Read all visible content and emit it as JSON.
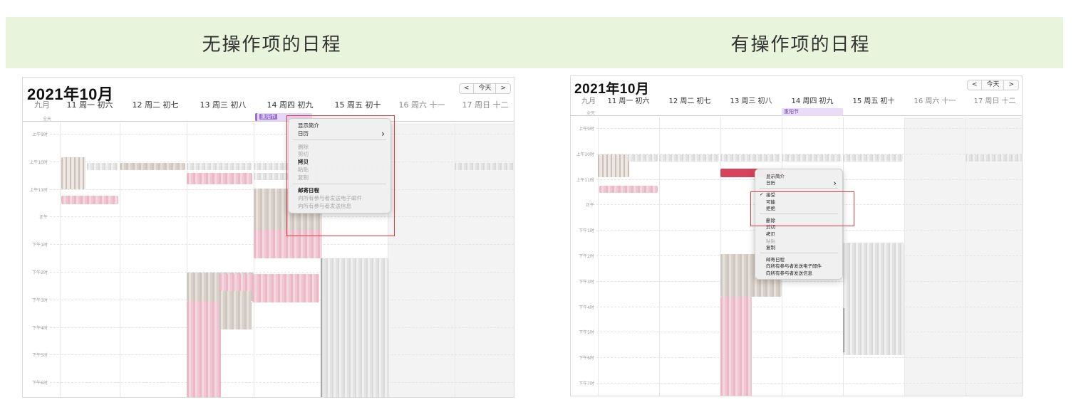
{
  "banners": {
    "left": "无操作项的日程",
    "right": "有操作项的日程"
  },
  "left_calendar": {
    "title": "2021年10月",
    "nav": {
      "prev": "<",
      "today": "今天",
      "next": ">"
    },
    "month_label": "九月",
    "days": [
      {
        "label": "11 周一  初六"
      },
      {
        "label": "12 周二  初七"
      },
      {
        "label": "13 周三  初八"
      },
      {
        "label": "14 周四  初九"
      },
      {
        "label": "15 周五  初十"
      },
      {
        "label": "16 周六  十一"
      },
      {
        "label": "17 周日  十二"
      }
    ],
    "allday_label": "全天",
    "holiday": "重阳节",
    "time_labels": [
      "上午9时",
      "上午10时",
      "上午11时",
      "正午",
      "下午1时",
      "下午2时",
      "下午3时",
      "下午4时",
      "下午5时",
      "下午6时"
    ],
    "menu": {
      "items": [
        {
          "label": "显示简介",
          "disabled": false,
          "bold": false
        },
        {
          "label": "日历",
          "disabled": false,
          "bold": false,
          "submenu": true
        },
        {
          "sep": true
        },
        {
          "label": "删除",
          "disabled": true,
          "bold": false
        },
        {
          "label": "剪切",
          "disabled": true,
          "bold": false
        },
        {
          "label": "拷贝",
          "disabled": false,
          "bold": true
        },
        {
          "label": "粘贴",
          "disabled": true,
          "bold": false
        },
        {
          "label": "复制",
          "disabled": true,
          "bold": false
        },
        {
          "sep": true
        },
        {
          "label": "邮寄日程",
          "disabled": false,
          "bold": true
        },
        {
          "label": "向所有参与者发送电子邮件",
          "disabled": true,
          "bold": false
        },
        {
          "label": "向所有参与者发送信息",
          "disabled": true,
          "bold": false
        }
      ]
    }
  },
  "right_calendar": {
    "title": "2021年10月",
    "nav": {
      "prev": "<",
      "today": "今天",
      "next": ">"
    },
    "month_label": "九月",
    "days": [
      {
        "label": "11 周一  初六"
      },
      {
        "label": "12 周二  初七"
      },
      {
        "label": "13 周三  初八"
      },
      {
        "label": "14 周四  初九"
      },
      {
        "label": "15 周五  初十"
      },
      {
        "label": "16 周六  十一"
      },
      {
        "label": "17 周日  十二"
      }
    ],
    "allday_label": "全天",
    "holiday": "重阳节",
    "time_labels": [
      "上午9时",
      "上午10时",
      "上午11时",
      "正午",
      "下午1时",
      "下午2时",
      "下午3时",
      "下午4时",
      "下午5时",
      "下午6时",
      "下午7时"
    ],
    "menu": {
      "items": [
        {
          "label": "显示简介",
          "disabled": false,
          "bold": false
        },
        {
          "label": "日历",
          "disabled": false,
          "bold": false,
          "submenu": true
        },
        {
          "sep": true
        },
        {
          "label": "接受",
          "disabled": false,
          "bold": false,
          "checked": true
        },
        {
          "label": "可能",
          "disabled": false,
          "bold": false
        },
        {
          "label": "拒绝",
          "disabled": false,
          "bold": false
        },
        {
          "sep": true
        },
        {
          "label": "删除",
          "disabled": false,
          "bold": false
        },
        {
          "label": "剪切",
          "disabled": false,
          "bold": false
        },
        {
          "label": "拷贝",
          "disabled": false,
          "bold": false
        },
        {
          "label": "粘贴",
          "disabled": true,
          "bold": false
        },
        {
          "label": "复制",
          "disabled": false,
          "bold": false
        },
        {
          "sep": true
        },
        {
          "label": "邮寄日程",
          "disabled": false,
          "bold": false
        },
        {
          "label": "向所有参与者发送电子邮件",
          "disabled": false,
          "bold": false
        },
        {
          "label": "向所有参与者发送信息",
          "disabled": false,
          "bold": false
        }
      ]
    }
  },
  "colors": {
    "banner_bg": "#e8f4dc",
    "highlight_red": "#e0393e",
    "holiday_purple": "#9a6fd0",
    "event_red": "#d6435a"
  },
  "icons": {
    "check": "✓",
    "submenu_arrow": "›"
  }
}
